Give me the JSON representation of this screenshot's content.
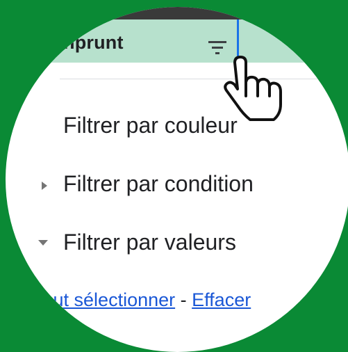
{
  "header": {
    "title": "nprunt"
  },
  "menu": {
    "items": [
      {
        "label": "Filtrer par couleur"
      },
      {
        "label": "Filtrer par condition",
        "caret": "collapsed"
      },
      {
        "label": "Filtrer par valeurs",
        "caret": "expanded"
      }
    ]
  },
  "actions": {
    "select_all": "Tout sélectionner",
    "separator": "-",
    "clear": "Effacer"
  },
  "colors": {
    "background": "#0a8a35",
    "header_fill": "#b7e1cd",
    "selection_border": "#1a73e8",
    "link": "#1a57d6"
  },
  "icons": {
    "filter": "filter-icon",
    "cursor": "hand-pointer-cursor-icon"
  }
}
